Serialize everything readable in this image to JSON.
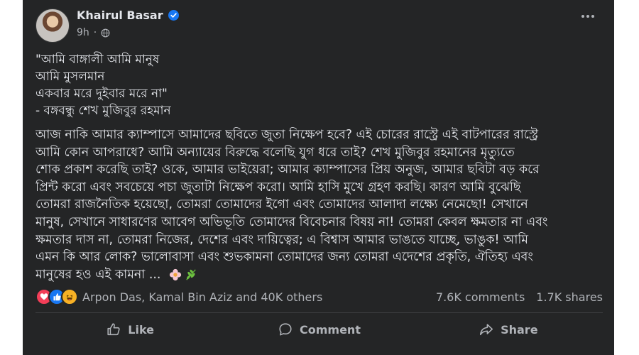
{
  "post": {
    "author": "Khairul Basar",
    "time": "9h",
    "verified_color": "#1877f2",
    "quote_lines": [
      "\"আমি বাঙ্গালী আমি মানুষ",
      "আমি মুসলমান",
      "একবার মরে দুইবার মরে না\"",
      "- বঙ্গবন্ধু শেখ মুজিবুর রহমান"
    ],
    "body_lines": [
      "আজ নাকি আমার ক্যাম্পাসে আমাদের ছবিতে জুতা নিক্ষেপ হবে? এই চোরের রাস্ট্রে এই বাটপারের রাস্ট্রে",
      "আমি কোন আপরাধে? আমি অন্যায়ের বিরুদ্ধে বলেছি যুগ ধরে তাই? শেখ মুজিবুর রহমানের মৃত্যুতে",
      "শোক প্রকাশ করেছি তাই? ওকে, আমার ভাইয়েরা; আমার ক্যাম্পাসের প্রিয় অনুজ, আমার ছবিটা বড় করে",
      "প্রিন্ট করো এবং সবচেয়ে পচা জুতাটা নিক্ষেপ করো। আমি হাসি মুখে গ্রহণ করছি। কারণ আমি বুঝেছি",
      "তোমরা রাজনৈতিক হয়েছো, তোমরা তোমাদের ইগো এবং তোমাদের আলাদা লক্ষ্যে নেমেছো! সেখানে",
      "মানুষ, সেখানে সাধারণের আবেগ অভিভূতি তোমাদের বিবেচনার বিষয় না! তোমরা কেবল ক্ষমতার না এবং",
      "ক্ষমতার দাস না, তোমরা নিজের, দেশের এবং দায়িত্বের; এ বিশ্বাস আমার ভাঙতে যাচ্ছে, ভাঙুক! আমি",
      "এমন কি আর লোক? ভালোবাসা এবং শুভকামনা তোমাদের জন্য তোমরা এদেশের প্রকৃতি, ঐতিহ্য এবং",
      "মানুষের হও এই কামনা ..."
    ],
    "reactions_names": "Arpon Das, Kamal Bin Aziz and 40K others",
    "comments_count": "7.6K comments",
    "shares_count": "1.7K shares"
  },
  "actions": {
    "like": "Like",
    "comment": "Comment",
    "share": "Share"
  },
  "icons": {
    "verified": "verified-badge-icon",
    "globe": "globe-icon",
    "more": "more-options-icon",
    "flower": "flower-icon",
    "herb": "herb-icon"
  },
  "colors": {
    "card_bg": "#242526",
    "text": "#e4e6eb",
    "muted": "#b0b3b8",
    "accent": "#1877f2"
  }
}
